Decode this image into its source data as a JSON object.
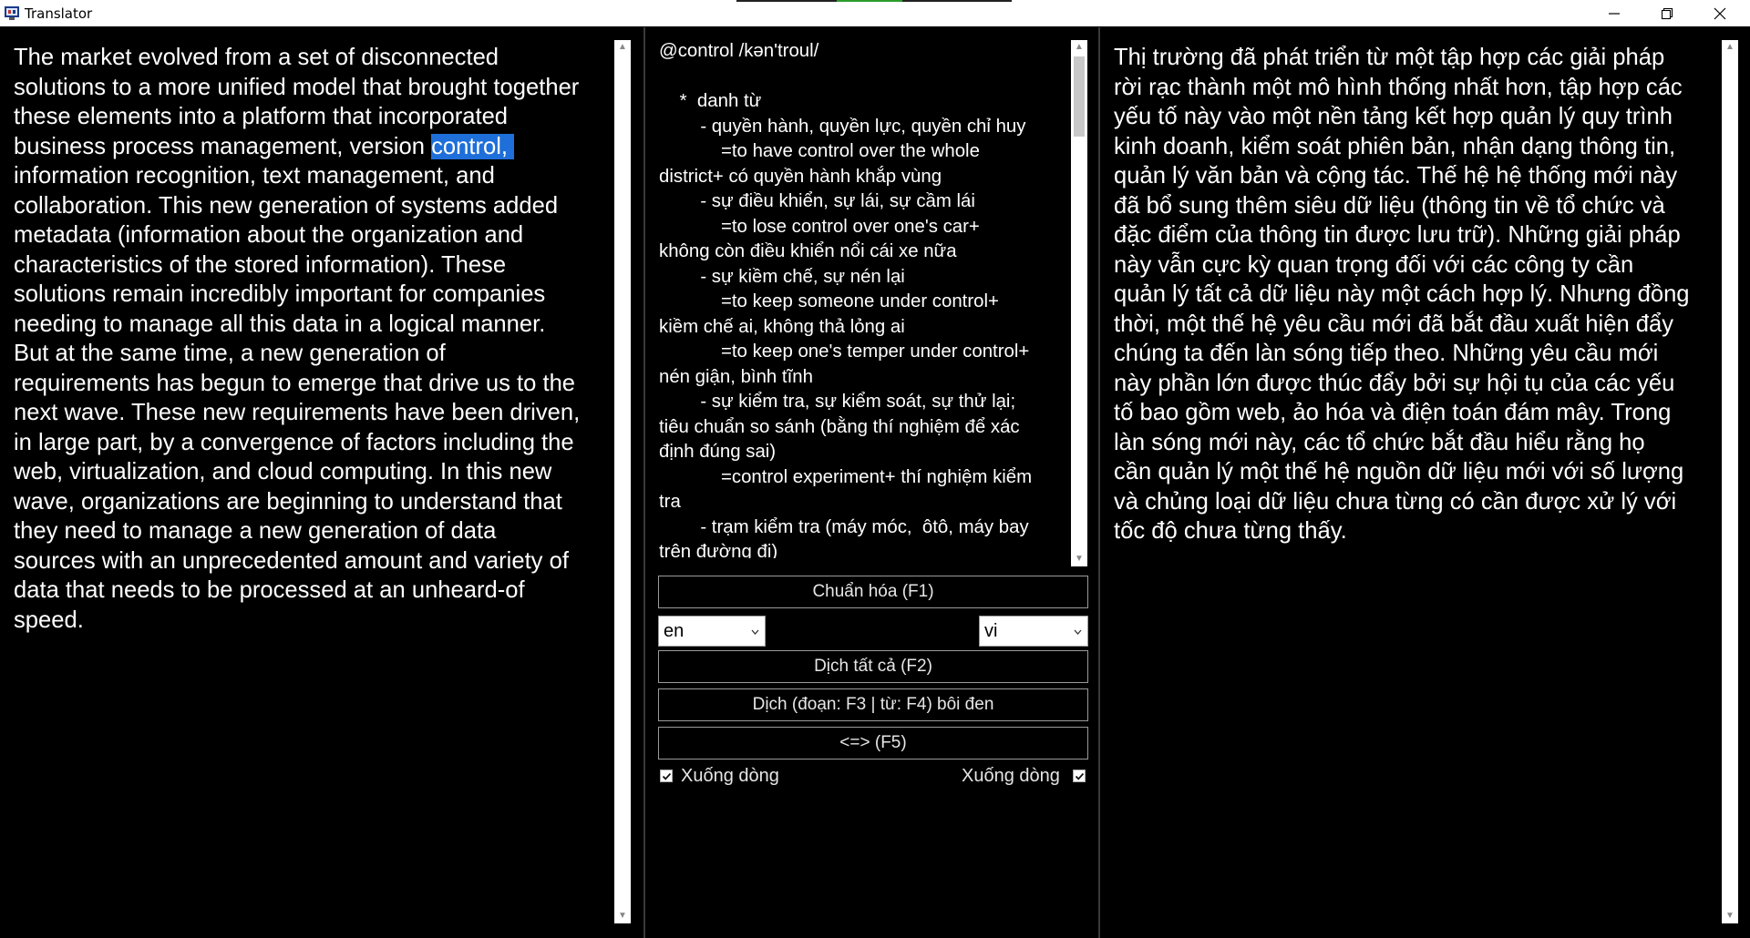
{
  "window": {
    "title": "Translator",
    "controls": [
      "minimize",
      "restore",
      "close"
    ]
  },
  "source": {
    "text_before": "The market evolved from a set of disconnected\nsolutions to a more unified model that brought together\nthese elements into a platform that incorporated\nbusiness process management, version ",
    "selected": "control, ",
    "text_after": "\ninformation recognition, text management, and\ncollaboration. This new generation of systems added\nmetadata (information about the organization and\ncharacteristics of the stored information). These\nsolutions remain incredibly important for companies\nneeding to manage all this data in a logical manner.\nBut at the same time, a new generation of\nrequirements has begun to emerge that drive us to the\nnext wave. These new requirements have been driven,\nin large part, by a convergence of factors including the\nweb, virtualization, and cloud computing. In this new\nwave, organizations are beginning to understand that\nthey need to manage a new generation of data\nsources with an unprecedented amount and variety of\ndata that needs to be processed at an unheard-of\nspeed."
  },
  "dictionary": {
    "text": "@control /kən'troul/\n\n    *  danh từ\n        - quyền hành, quyền lực, quyền chỉ huy\n            =to have control over the whole\ndistrict+ có quyền hành khắp vùng\n        - sự điều khiển, sự lái, sự cầm lái\n            =to lose control over one's car+\nkhông còn điều khiển nổi cái xe nữa\n        - sự kiềm chế, sự nén lại\n            =to keep someone under control+\nkiềm chế ai, không thả lỏng ai\n            =to keep one's temper under control+\nnén giận, bình tĩnh\n        - sự kiểm tra, sự kiểm soát, sự thử lại;\ntiêu chuẩn so sánh (bằng thí nghiệm để xác\nđịnh đúng sai)\n            =control experiment+ thí nghiệm kiểm\ntra\n        - trạm kiểm tra (máy móc,  ôtô, máy bay\ntrên đường đi)"
  },
  "controls": {
    "normalize_label": "Chuẩn hóa (F1)",
    "source_lang": "en",
    "target_lang": "vi",
    "translate_all_label": "Dịch tất cả (F2)",
    "translate_selected_label": "Dịch (đoạn: F3 | từ: F4) bôi đen",
    "swap_label": "<=> (F5)",
    "wrap_left_label": "Xuống dòng",
    "wrap_left_checked": true,
    "wrap_right_label": "Xuống dòng",
    "wrap_right_checked": true
  },
  "target": {
    "text": "Thị trường đã phát triển từ một tập hợp các giải pháp\nrời rạc thành một mô hình thống nhất hơn, tập hợp các\nyếu tố này vào một nền tảng kết hợp quản lý quy trình\nkinh doanh, kiểm soát phiên bản, nhận dạng thông tin,\nquản lý văn bản và cộng tác. Thế hệ hệ thống mới này\nđã bổ sung thêm siêu dữ liệu (thông tin về tổ chức và\nđặc điểm của thông tin được lưu trữ). Những giải pháp\nnày vẫn cực kỳ quan trọng đối với các công ty cần\nquản lý tất cả dữ liệu này một cách hợp lý. Nhưng đồng\nthời, một thế hệ yêu cầu mới đã bắt đầu xuất hiện đẩy\nchúng ta đến làn sóng tiếp theo. Những yêu cầu mới\nnày phần lớn được thúc đẩy bởi sự hội tụ của các yếu\ntố bao gồm web, ảo hóa và điện toán đám mây. Trong\nlàn sóng mới này, các tổ chức bắt đầu hiểu rằng họ\ncần quản lý một thế hệ nguồn dữ liệu mới với số lượng\nvà chủng loại dữ liệu chưa từng có cần được xử lý với\ntốc độ chưa từng thấy."
  },
  "colors": {
    "background": "#000000",
    "text": "#ffffff",
    "selection": "#1e6fd9",
    "border": "#9a9a9a"
  }
}
